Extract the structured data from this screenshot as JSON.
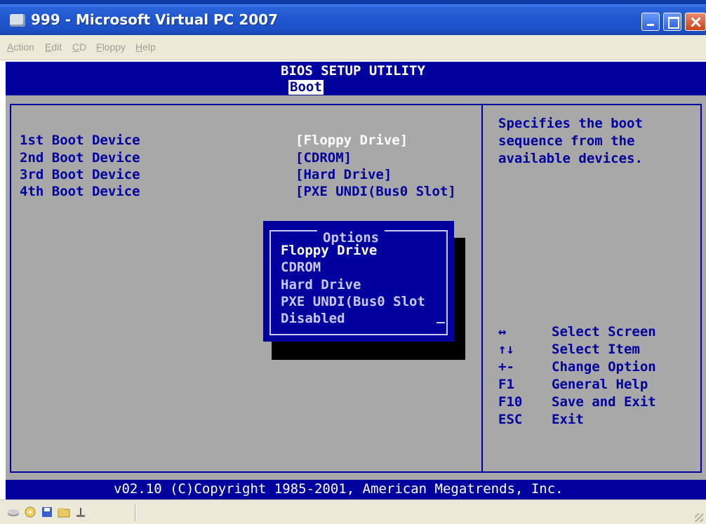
{
  "window": {
    "title": "999 - Microsoft Virtual PC 2007",
    "icon": "virtual-pc-icon",
    "controls": [
      "minimize",
      "maximize",
      "close"
    ]
  },
  "menu": {
    "items": [
      {
        "label": "Action",
        "mnemonic": "A"
      },
      {
        "label": "Edit",
        "mnemonic": "E"
      },
      {
        "label": "CD",
        "mnemonic": "C"
      },
      {
        "label": "Floppy",
        "mnemonic": "F"
      },
      {
        "label": "Help",
        "mnemonic": "H"
      }
    ]
  },
  "bios": {
    "title": "BIOS SETUP UTILITY",
    "active_tab": "Boot",
    "boot_devices": [
      {
        "label": "1st Boot Device",
        "value": "[Floppy Drive]"
      },
      {
        "label": "2nd Boot Device",
        "value": "[CDROM]"
      },
      {
        "label": "3rd Boot Device",
        "value": "[Hard Drive]"
      },
      {
        "label": "4th Boot Device",
        "value": "[PXE UNDI(Bus0 Slot]"
      }
    ],
    "help": {
      "line1": "Specifies the boot",
      "line2": "sequence from the",
      "line3": "available devices."
    },
    "keys": [
      {
        "key": "↔",
        "desc": "Select Screen"
      },
      {
        "key": "↑↓",
        "desc": "Select Item"
      },
      {
        "key": "+-",
        "desc": "Change Option"
      },
      {
        "key": "F1",
        "desc": "General Help"
      },
      {
        "key": "F10",
        "desc": "Save and Exit"
      },
      {
        "key": "ESC",
        "desc": "Exit"
      }
    ],
    "options_popup": {
      "title": "Options",
      "selected": "Floppy Drive",
      "items": [
        "Floppy Drive",
        "CDROM",
        "Hard Drive",
        "PXE UNDI(Bus0 Slot",
        "Disabled"
      ]
    },
    "footer": "v02.10 (C)Copyright 1985-2001, American Megatrends, Inc."
  },
  "statusbar": {
    "icons": [
      "network-icon",
      "cd-icon",
      "floppy-icon",
      "folder-icon",
      "usb-icon"
    ]
  },
  "colors": {
    "bios_blue": "#00009e",
    "bios_gray": "#a8a8a8",
    "xp_blue": "#1f56cf"
  }
}
